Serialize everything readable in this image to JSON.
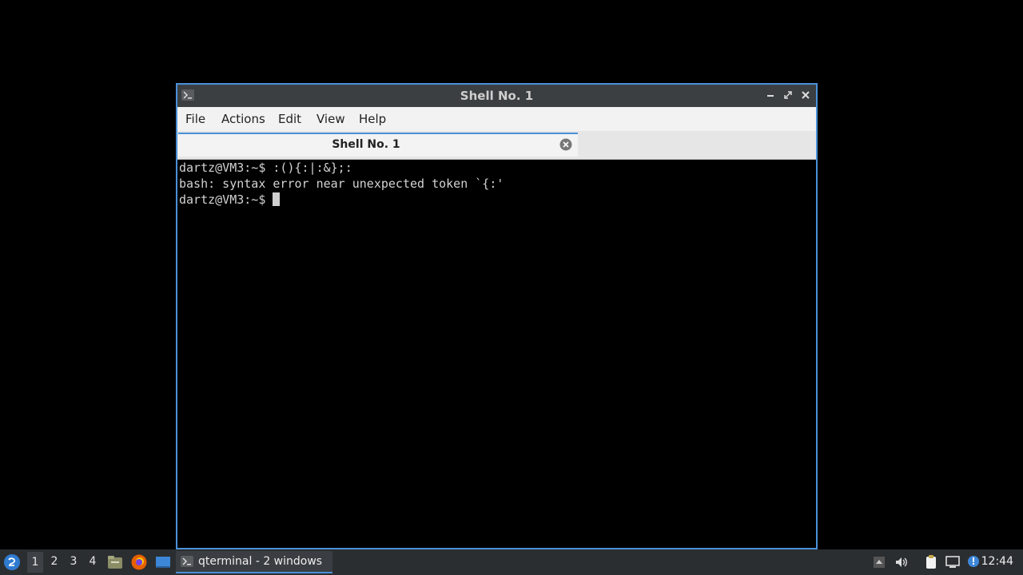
{
  "window": {
    "title": "Shell No. 1",
    "menu": [
      "File",
      "Actions",
      "Edit",
      "View",
      "Help"
    ],
    "tab_label": "Shell No. 1"
  },
  "terminal": {
    "lines": [
      "dartz@VM3:~$ :(){:|:&};:",
      "bash: syntax error near unexpected token `{:'",
      "dartz@VM3:~$ "
    ]
  },
  "taskbar": {
    "desktops": [
      "1",
      "2",
      "3",
      "4"
    ],
    "active_desktop": "1",
    "task_label": "qterminal - 2 windows",
    "clock": "12:44",
    "icons": [
      "start-menu-icon",
      "file-manager-icon",
      "firefox-icon",
      "show-desktop-icon",
      "terminal-icon",
      "tray-arrow-icon",
      "volume-icon",
      "clipboard-icon",
      "network-icon",
      "update-notifier-icon"
    ]
  },
  "colors": {
    "accent": "#4a90d9",
    "titlebar": "#3c3f41",
    "terminal_bg": "#000000",
    "terminal_fg": "#d2d2d2"
  }
}
